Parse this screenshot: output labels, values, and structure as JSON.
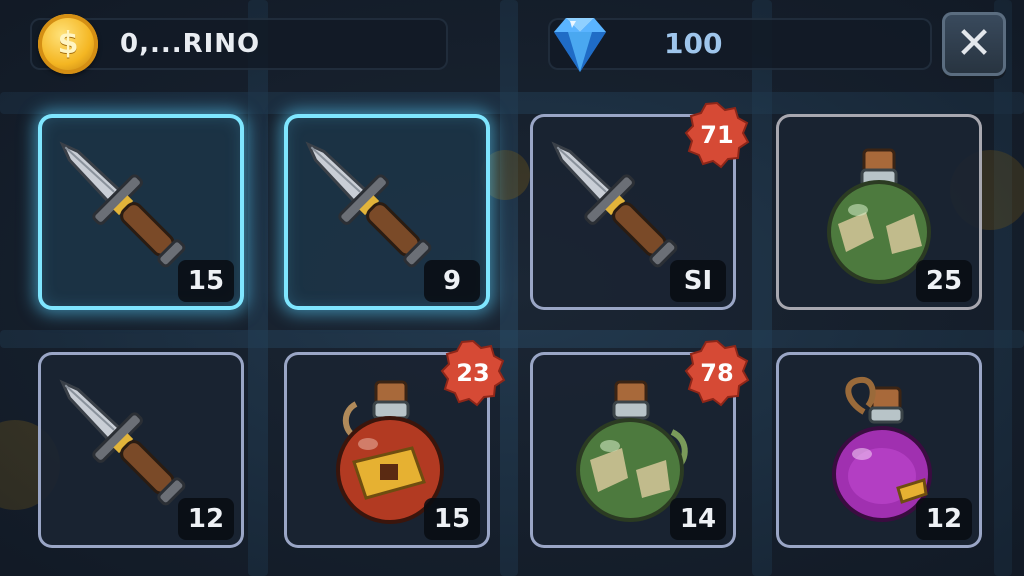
{
  "header": {
    "coins": {
      "value": "0,...RINO",
      "icon": "coin-icon",
      "symbol": "$"
    },
    "gems": {
      "value": "100",
      "icon": "diamond-icon"
    },
    "close": {
      "icon": "close-icon",
      "label": "✕"
    }
  },
  "inventory": {
    "slots": [
      {
        "item": "sword",
        "count": "15",
        "selected": true,
        "badge": null
      },
      {
        "item": "sword",
        "count": "9",
        "selected": true,
        "badge": null
      },
      {
        "item": "sword",
        "count": "SI",
        "selected": false,
        "badge": "71"
      },
      {
        "item": "green-potion",
        "count": "25",
        "selected": false,
        "badge": null
      },
      {
        "item": "sword",
        "count": "12",
        "selected": false,
        "badge": null
      },
      {
        "item": "red-potion",
        "count": "15",
        "selected": false,
        "badge": "23"
      },
      {
        "item": "green-potion",
        "count": "14",
        "selected": false,
        "badge": "78"
      },
      {
        "item": "purple-potion",
        "count": "12",
        "selected": false,
        "badge": null
      }
    ]
  },
  "colors": {
    "selected_glow": "#7fe6ff",
    "badge_red": "#d64a35",
    "coin_gold": "#f4b622",
    "gem_blue": "#4aa8f0"
  }
}
